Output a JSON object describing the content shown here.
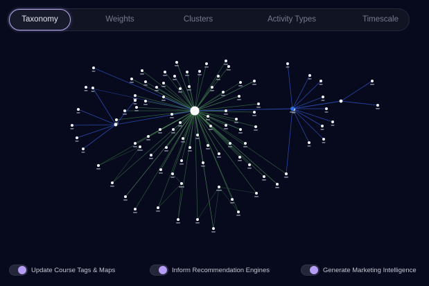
{
  "tabs": [
    {
      "label": "Taxonomy",
      "active": true
    },
    {
      "label": "Weights",
      "active": false
    },
    {
      "label": "Clusters",
      "active": false
    },
    {
      "label": "Activity Types",
      "active": false
    },
    {
      "label": "Timescale",
      "active": false
    }
  ],
  "toggles": [
    {
      "label": "Update Course Tags & Maps",
      "on": true
    },
    {
      "label": "Inform Recommendation Engines",
      "on": true
    },
    {
      "label": "Generate Marketing Intelligence",
      "on": true
    }
  ],
  "colors": {
    "accent": "#b59cf5",
    "edge_green": "#3f7a4e",
    "edge_blue": "#2d4fbd",
    "hub_blue": "#2f6be0",
    "background": "#070a1c"
  }
}
